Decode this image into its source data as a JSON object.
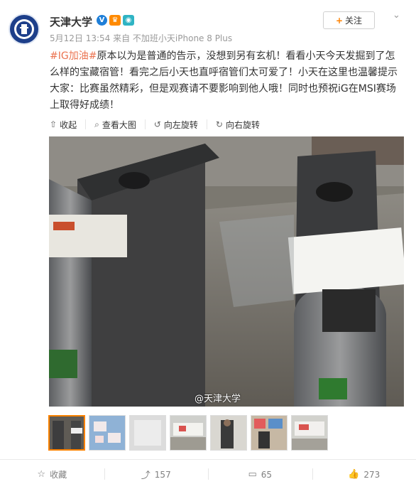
{
  "post": {
    "username": "天津大学",
    "badge_v": "V",
    "meta": "5月12日 13:54 来自 不加班小天iPhone 8 Plus",
    "follow_label": "关注",
    "text_tag": "#IG加油#",
    "text_body": "原本以为是普通的告示，没想到另有玄机！看看小天今天发掘到了怎么样的宝藏宿管！看完之后小天也直呼宿管们太可爱了！小天在这里也温馨提示大家：比赛虽然精彩，但是观赛请不要影响到他人哦！同时也预祝iG在MSI赛场上取得好成绩！",
    "watermark": "@天津大学"
  },
  "toolbar": {
    "collapse": "收起",
    "view_large": "查看大图",
    "rotate_left": "向左旋转",
    "rotate_right": "向右旋转"
  },
  "actions": {
    "favorite": "收藏",
    "repost_count": "157",
    "comment_count": "65",
    "like_count": "273"
  },
  "colors": {
    "accent": "#ff8200",
    "hashtag": "#eb7350",
    "verified": "#1f7fd8"
  }
}
